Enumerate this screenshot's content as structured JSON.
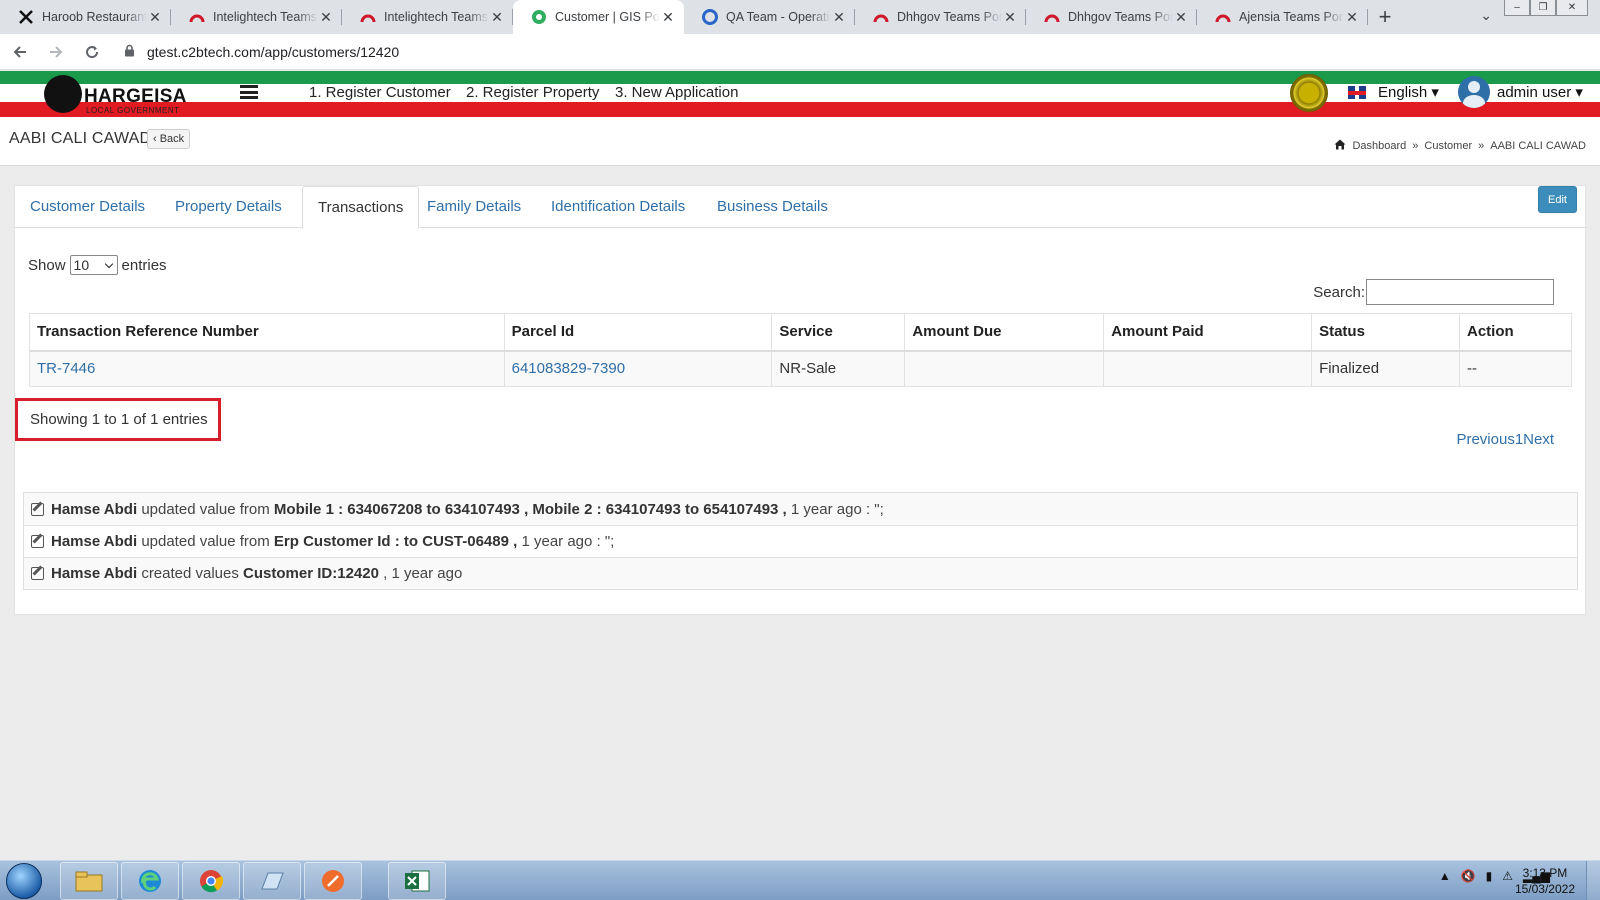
{
  "browser": {
    "tabs": [
      {
        "title": "Haroob Restaurant P",
        "icon": "x-logo-icon"
      },
      {
        "title": "Intelightech Teams P",
        "icon": "teams-arch-icon"
      },
      {
        "title": "Intelightech Teams P",
        "icon": "teams-arch-icon"
      },
      {
        "title": "Customer | GIS Porta",
        "icon": "gis-globe-icon",
        "active": true
      },
      {
        "title": "QA Team - Operatio",
        "icon": "qa-circle-icon"
      },
      {
        "title": "Dhhgov Teams Porta",
        "icon": "teams-arch-icon"
      },
      {
        "title": "Dhhgov Teams Porta",
        "icon": "teams-arch-icon"
      },
      {
        "title": "Ajensia Teams Porta",
        "icon": "teams-arch-icon"
      }
    ],
    "new_tab": "+",
    "url": "gtest.c2btech.com/app/customers/12420"
  },
  "app": {
    "logo_text": "HARGEISA",
    "logo_sub": "LOCAL GOVERNMENT",
    "nav": [
      "1. Register Customer",
      "2. Register Property",
      "3. New Application"
    ],
    "language": "English ▾",
    "user": "admin user ▾"
  },
  "page": {
    "title": "AABI CALI CAWAD",
    "back": "‹ Back",
    "breadcrumb": [
      "Dashboard",
      "»",
      "Customer",
      "»",
      "AABI CALI CAWAD"
    ]
  },
  "tabs": [
    "Customer Details",
    "Property Details",
    "Transactions",
    "Family Details",
    "Identification Details",
    "Business Details"
  ],
  "active_tab": "Transactions",
  "edit_label": "Edit",
  "table": {
    "show_label": "Show",
    "length_value": "10",
    "entries_label": "entries",
    "search_label": "Search:",
    "search_value": "",
    "columns": [
      "Transaction Reference Number",
      "Parcel Id",
      "Service",
      "Amount Due",
      "Amount Paid",
      "Status",
      "Action"
    ],
    "rows": [
      [
        "TR-7446",
        "641083829-7390",
        "NR-Sale",
        "",
        "",
        "Finalized",
        "--"
      ]
    ],
    "info": "Showing 1 to 1 of 1 entries",
    "pagination": "Previous1Next"
  },
  "audit_log": [
    {
      "user": "Hamse Abdi",
      "verb": "updated value from",
      "detail": "Mobile 1 : 634067208 to 634107493 , Mobile 2 : 634107493 to 654107493 ,",
      "tail": "1 year ago : \";"
    },
    {
      "user": "Hamse Abdi",
      "verb": "updated value from",
      "detail": "Erp Customer Id : to CUST-06489 ,",
      "tail": "1 year ago : \";"
    },
    {
      "user": "Hamse Abdi",
      "verb": "created values",
      "detail": "Customer ID:12420",
      "tail": ", 1 year ago"
    }
  ],
  "taskbar": {
    "time": "3:13 PM",
    "date": "15/03/2022"
  },
  "colors": {
    "flag_green": "#1a9a4a",
    "flag_red": "#e21b23",
    "link_blue": "#2f6fa8",
    "edit_button": "#3c8dbc",
    "highlight_box": "#d81e2a"
  }
}
